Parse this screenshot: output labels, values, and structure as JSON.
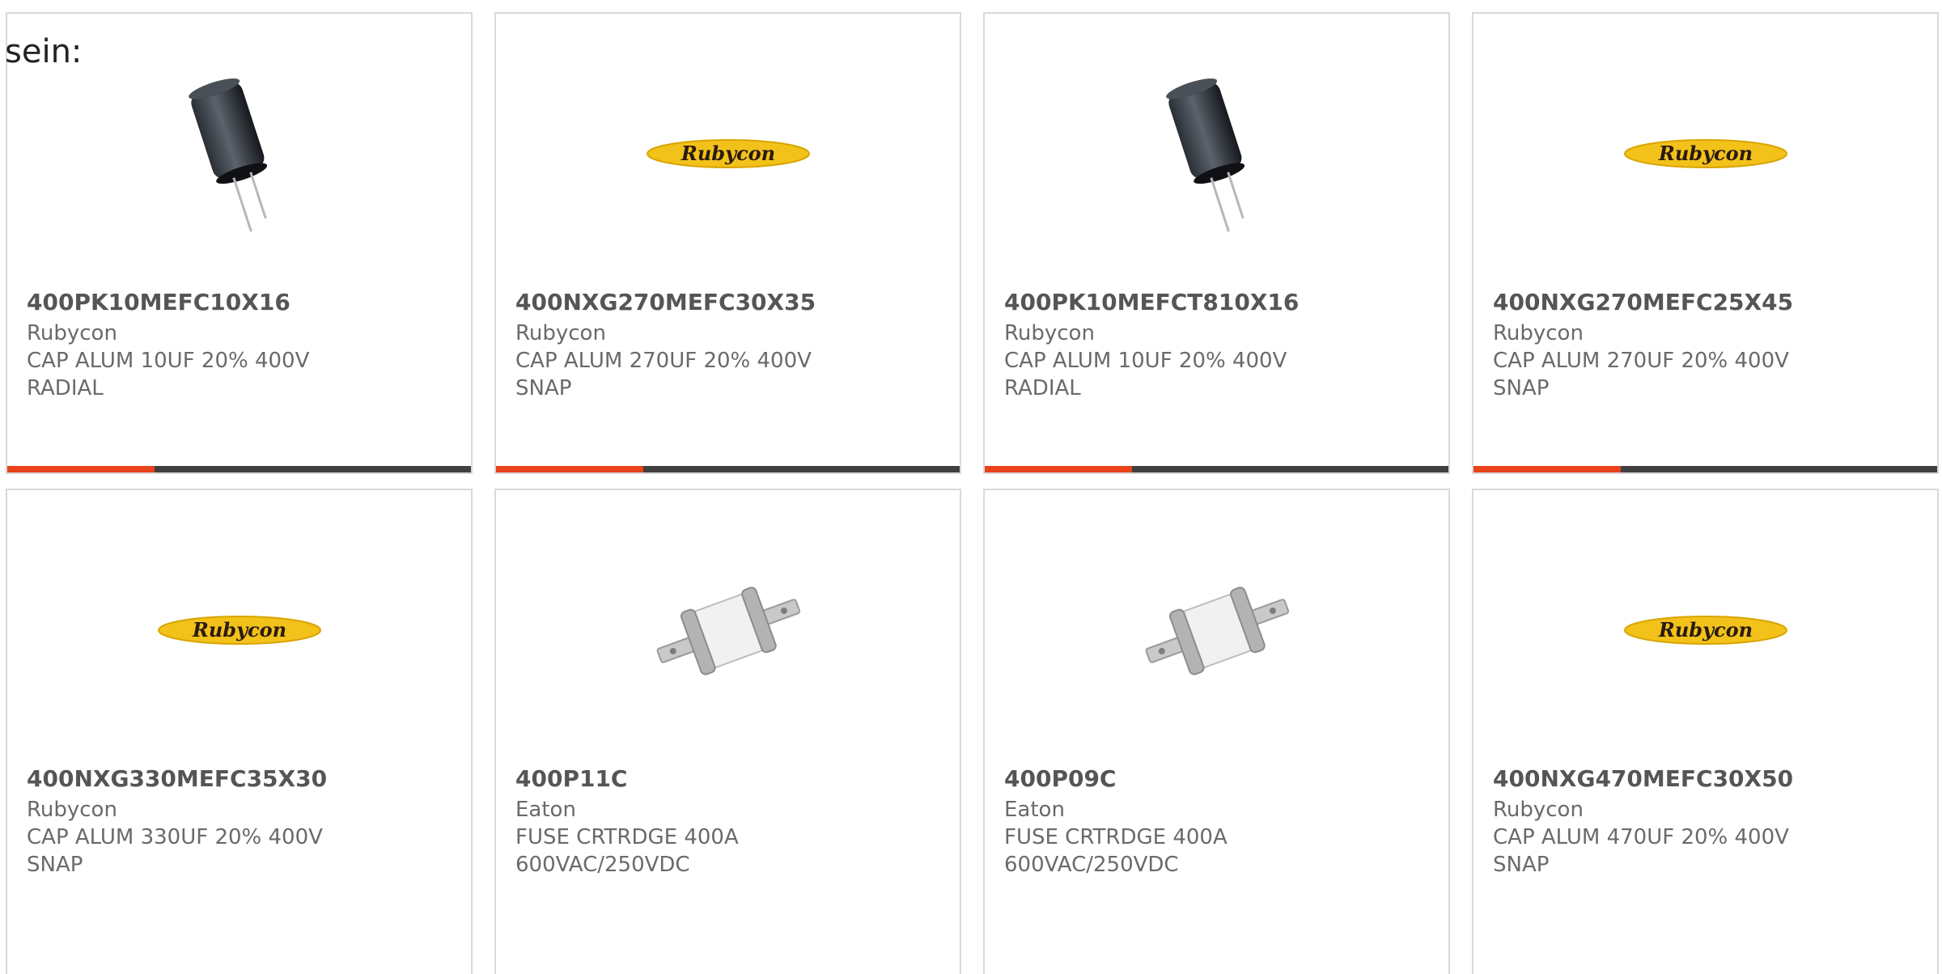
{
  "lead_text": "sein:",
  "colors": {
    "accent": "#e8431a",
    "bar": "#404040",
    "card_border": "#d9d9d9",
    "logo_yellow": "#f2c21b"
  },
  "products": [
    {
      "part_number": "400PK10MEFC10X16",
      "manufacturer": "Rubycon",
      "desc_line1": "CAP ALUM 10UF 20% 400V",
      "desc_line2": "RADIAL",
      "image": "capacitor-icon"
    },
    {
      "part_number": "400NXG270MEFC30X35",
      "manufacturer": "Rubycon",
      "desc_line1": "CAP ALUM 270UF 20% 400V",
      "desc_line2": "SNAP",
      "image": "rubycon-logo",
      "logo_text": "Rubycon"
    },
    {
      "part_number": "400PK10MEFCT810X16",
      "manufacturer": "Rubycon",
      "desc_line1": "CAP ALUM 10UF 20% 400V",
      "desc_line2": "RADIAL",
      "image": "capacitor-icon"
    },
    {
      "part_number": "400NXG270MEFC25X45",
      "manufacturer": "Rubycon",
      "desc_line1": "CAP ALUM 270UF 20% 400V",
      "desc_line2": "SNAP",
      "image": "rubycon-logo",
      "logo_text": "Rubycon"
    },
    {
      "part_number": "400NXG330MEFC35X30",
      "manufacturer": "Rubycon",
      "desc_line1": "CAP ALUM 330UF 20% 400V",
      "desc_line2": "SNAP",
      "image": "rubycon-logo",
      "logo_text": "Rubycon"
    },
    {
      "part_number": "400P11C",
      "manufacturer": "Eaton",
      "desc_line1": "FUSE CRTRDGE 400A",
      "desc_line2": "600VAC/250VDC",
      "image": "fuse-icon"
    },
    {
      "part_number": "400P09C",
      "manufacturer": "Eaton",
      "desc_line1": "FUSE CRTRDGE 400A",
      "desc_line2": "600VAC/250VDC",
      "image": "fuse-icon"
    },
    {
      "part_number": "400NXG470MEFC30X50",
      "manufacturer": "Rubycon",
      "desc_line1": "CAP ALUM 470UF 20% 400V",
      "desc_line2": "SNAP",
      "image": "rubycon-logo",
      "logo_text": "Rubycon"
    }
  ]
}
